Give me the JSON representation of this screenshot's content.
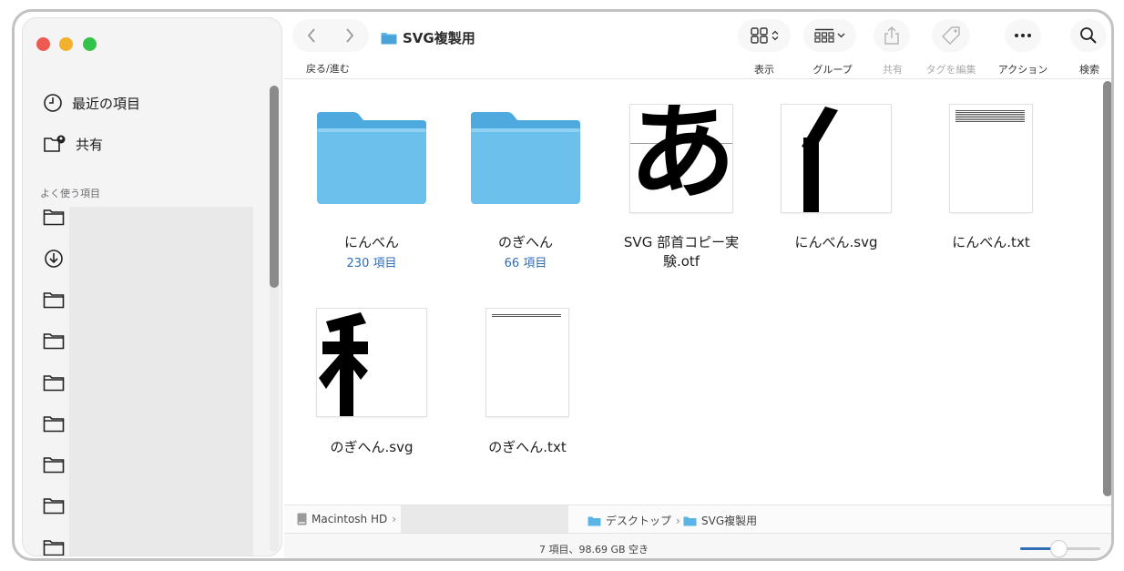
{
  "window": {
    "title": "SVG複製用",
    "nav_caption": "戻る/進む"
  },
  "sidebar": {
    "items": [
      {
        "label": "最近の項目",
        "icon": "clock-icon"
      },
      {
        "label": "共有",
        "icon": "shared-folder-icon"
      }
    ],
    "section_label": "よく使う項目",
    "favorites_icons": [
      "folder-icon",
      "download-icon",
      "folder-icon",
      "folder-icon",
      "folder-icon",
      "folder-icon",
      "folder-icon",
      "folder-icon",
      "folder-icon"
    ]
  },
  "toolbar": {
    "view_label": "表示",
    "group_label": "グループ",
    "share_label": "共有",
    "tag_label": "タグを編集",
    "action_label": "アクション",
    "search_label": "検索"
  },
  "files": [
    {
      "name": "にんべん",
      "count": "230 項目",
      "kind": "folder"
    },
    {
      "name": "のぎへん",
      "count": "66 項目",
      "kind": "folder"
    },
    {
      "name_line1": "SVG 部首コピー実",
      "name_line2": "験.otf",
      "kind": "font",
      "glyph": "あ"
    },
    {
      "name": "にんべん.svg",
      "kind": "svg",
      "glyph": "亻"
    },
    {
      "name": "にんべん.txt",
      "kind": "txt"
    },
    {
      "name": "のぎへん.svg",
      "kind": "svg",
      "glyph": "禾"
    },
    {
      "name": "のぎへん.txt",
      "kind": "txt"
    }
  ],
  "pathbar": {
    "disk": "Macintosh HD",
    "desktop": "デスクトップ",
    "folder": "SVG複製用"
  },
  "status": {
    "text": "7 項目、98.69 GB 空き",
    "icon_size_fraction": 0.48
  },
  "colors": {
    "folder_blue": "#5ab4e6",
    "accent": "#2f6db5"
  }
}
